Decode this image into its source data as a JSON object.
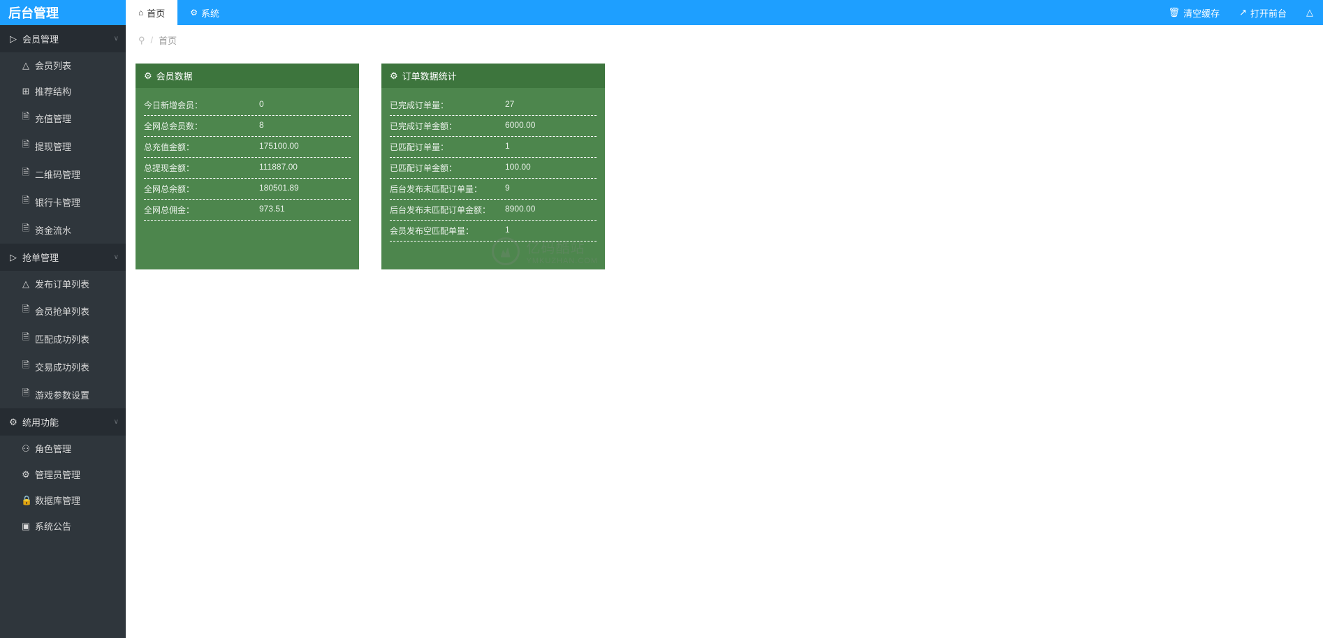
{
  "header": {
    "logo": "后台管理",
    "tabs": [
      {
        "label": "首页",
        "icon": "home",
        "active": true
      },
      {
        "label": "系统",
        "icon": "gear",
        "active": false
      }
    ],
    "right": [
      {
        "label": "清空缓存",
        "icon": "trash"
      },
      {
        "label": "打开前台",
        "icon": "external"
      }
    ]
  },
  "breadcrumb": {
    "current": "首页"
  },
  "sidebar": {
    "groups": [
      {
        "header": "会员管理",
        "icon": "folder",
        "items": [
          {
            "label": "会员列表",
            "icon": "user"
          },
          {
            "label": "推荐结构",
            "icon": "grid"
          },
          {
            "label": "充值管理",
            "icon": "doc"
          },
          {
            "label": "提现管理",
            "icon": "doc"
          },
          {
            "label": "二维码管理",
            "icon": "doc"
          },
          {
            "label": "银行卡管理",
            "icon": "doc"
          },
          {
            "label": "资金流水",
            "icon": "doc"
          }
        ]
      },
      {
        "header": "抢单管理",
        "icon": "folder",
        "items": [
          {
            "label": "发布订单列表",
            "icon": "user"
          },
          {
            "label": "会员抢单列表",
            "icon": "doc"
          },
          {
            "label": "匹配成功列表",
            "icon": "doc"
          },
          {
            "label": "交易成功列表",
            "icon": "doc"
          },
          {
            "label": "游戏参数设置",
            "icon": "doc"
          }
        ]
      },
      {
        "header": "统用功能",
        "icon": "gear",
        "items": [
          {
            "label": "角色管理",
            "icon": "org"
          },
          {
            "label": "管理员管理",
            "icon": "gear"
          },
          {
            "label": "数据库管理",
            "icon": "lock"
          },
          {
            "label": "系统公告",
            "icon": "clip"
          }
        ]
      }
    ]
  },
  "cards": [
    {
      "title": "会员数据",
      "rows": [
        {
          "label": "今日新增会员：",
          "value": "0"
        },
        {
          "label": "全网总会员数：",
          "value": "8"
        },
        {
          "label": "总充值金额：",
          "value": "175100.00"
        },
        {
          "label": "总提现金额：",
          "value": "111887.00"
        },
        {
          "label": "全网总余额：",
          "value": "180501.89"
        },
        {
          "label": "全网总佣金：",
          "value": "973.51"
        }
      ]
    },
    {
      "title": "订单数据统计",
      "rows": [
        {
          "label": "已完成订单量：",
          "value": "27"
        },
        {
          "label": "已完成订单金额：",
          "value": "6000.00"
        },
        {
          "label": "已匹配订单量：",
          "value": "1"
        },
        {
          "label": "已匹配订单金额：",
          "value": "100.00"
        },
        {
          "label": "后台发布未匹配订单量：",
          "value": "9"
        },
        {
          "label": "后台发布未匹配订单金额：",
          "value": "8900.00"
        },
        {
          "label": "会员发布空匹配单量：",
          "value": "1"
        }
      ]
    }
  ],
  "watermark": {
    "zh": "亿码酷站",
    "en": "YMKUZHAN.COM"
  },
  "icons": {
    "home": "⌂",
    "gear": "⚙",
    "trash": "🗑",
    "external": "↗",
    "user": "△",
    "folder": "▷",
    "doc": "🗎",
    "grid": "⊞",
    "org": "⚇",
    "lock": "🔒",
    "clip": "▣",
    "pin": "⚲",
    "chevron": "∨"
  }
}
